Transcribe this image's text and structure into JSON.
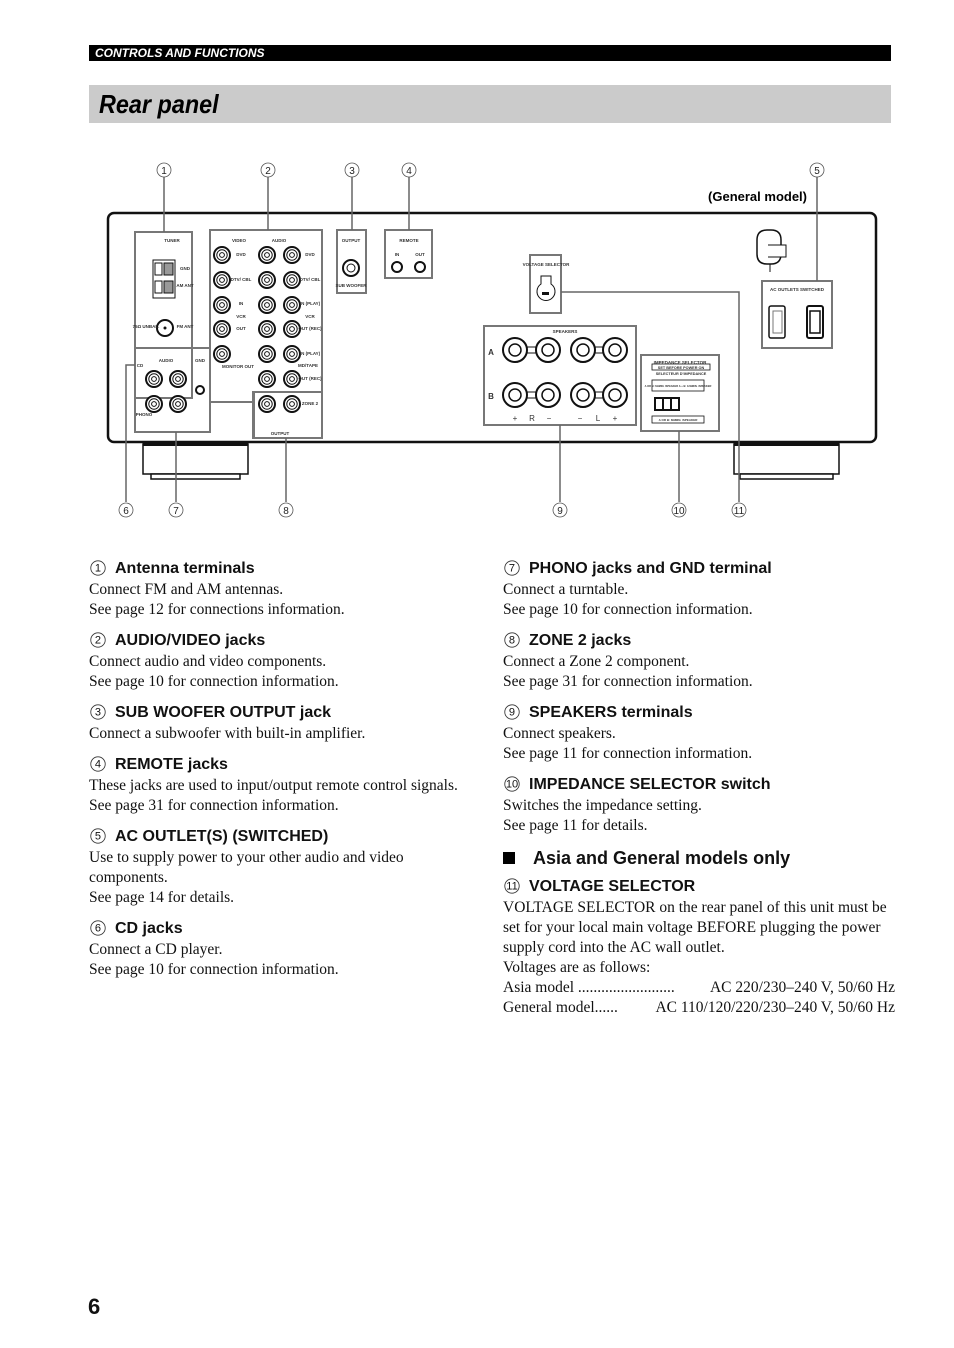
{
  "header": {
    "section_label": "CONTROLS AND FUNCTIONS"
  },
  "page_title": "Rear panel",
  "diagram": {
    "model_note": "(General model)",
    "callouts_top": [
      "1",
      "2",
      "3",
      "4",
      "5"
    ],
    "callouts_bottom": [
      "6",
      "7",
      "8",
      "9",
      "10",
      "11"
    ],
    "labels": {
      "tuner": "TUNER",
      "gnd": "GND",
      "am_ant": "AM ANT",
      "unbal": "75Ω UNBAL.",
      "fm_ant": "FM ANT",
      "video": "VIDEO",
      "audio": "AUDIO",
      "dvd": "DVD",
      "dtv_cbl": "DTV/ CBL",
      "in": "IN",
      "vcr": "VCR",
      "out": "OUT",
      "in_play": "IN (PLAY)",
      "out_rec": "OUT (REC)",
      "monitor_out": "MONITOR OUT",
      "md_tape": "MD/TAPE",
      "zone2": "ZONE 2",
      "output": "OUTPUT",
      "cd": "CD",
      "phono": "PHONO",
      "sub_output": "OUTPUT",
      "sub_woofer": "SUB WOOFER",
      "remote": "REMOTE",
      "remote_in": "IN",
      "remote_out": "OUT",
      "voltage_selector": "VOLTAGE SELECTOR",
      "speakers": "SPEAKERS",
      "spk_a": "A",
      "spk_b": "B",
      "impedance_selector": "IMPEDANCE SELECTOR",
      "set_before": "SET BEFORE POWER ON",
      "selecteur": "SELECTEUR D'IMPEDANCE",
      "imp_opt1": "A OR B: 6ΩMIN. /SPEAKER A + B: 12ΩMIN. /SPEAKER",
      "imp_opt2": "A OR B: 8ΩMIN. /SPEAKER",
      "ac_outlets": "AC OUTLETS SWITCHED"
    }
  },
  "items_left": [
    {
      "num": "1",
      "title": "Antenna terminals",
      "lines": [
        "Connect FM and AM antennas.",
        "See page 12 for connections information."
      ]
    },
    {
      "num": "2",
      "title": "AUDIO/VIDEO jacks",
      "lines": [
        "Connect audio and video components.",
        "See page 10 for connection information."
      ]
    },
    {
      "num": "3",
      "title": "SUB WOOFER OUTPUT jack",
      "lines": [
        "Connect a subwoofer with built-in amplifier."
      ]
    },
    {
      "num": "4",
      "title": "REMOTE jacks",
      "lines": [
        "These jacks are used to input/output remote control signals.",
        "See page 31 for connection information."
      ]
    },
    {
      "num": "5",
      "title": "AC OUTLET(S) (SWITCHED)",
      "lines": [
        "Use to supply power to your other audio and video components.",
        "See page 14 for details."
      ]
    },
    {
      "num": "6",
      "title": "CD jacks",
      "lines": [
        "Connect a CD player.",
        "See page 10 for connection information."
      ]
    }
  ],
  "items_right": [
    {
      "num": "7",
      "title": "PHONO jacks and GND terminal",
      "lines": [
        "Connect a turntable.",
        "See page 10 for connection information."
      ]
    },
    {
      "num": "8",
      "title": "ZONE 2 jacks",
      "lines": [
        "Connect a Zone 2 component.",
        "See page 31 for connection information."
      ]
    },
    {
      "num": "9",
      "title": "SPEAKERS terminals",
      "lines": [
        "Connect speakers.",
        "See page 11 for connection information."
      ]
    },
    {
      "num": "10",
      "title": "IMPEDANCE SELECTOR switch",
      "lines": [
        "Switches the impedance setting.",
        "See page 11 for details."
      ]
    }
  ],
  "asia_section": {
    "heading": "Asia and General models only",
    "item": {
      "num": "11",
      "title": "VOLTAGE SELECTOR",
      "lines": [
        "VOLTAGE SELECTOR on the rear panel of this unit must be set for your local main voltage BEFORE plugging the power supply cord into the AC wall outlet.",
        "Voltages are as follows:"
      ]
    },
    "voltages": [
      {
        "model": "Asia model .........................",
        "value": "AC 220/230–240 V, 50/60 Hz"
      },
      {
        "model": "General model......",
        "value": "AC 110/120/220/230–240 V, 50/60 Hz"
      }
    ]
  },
  "page_number": "6"
}
